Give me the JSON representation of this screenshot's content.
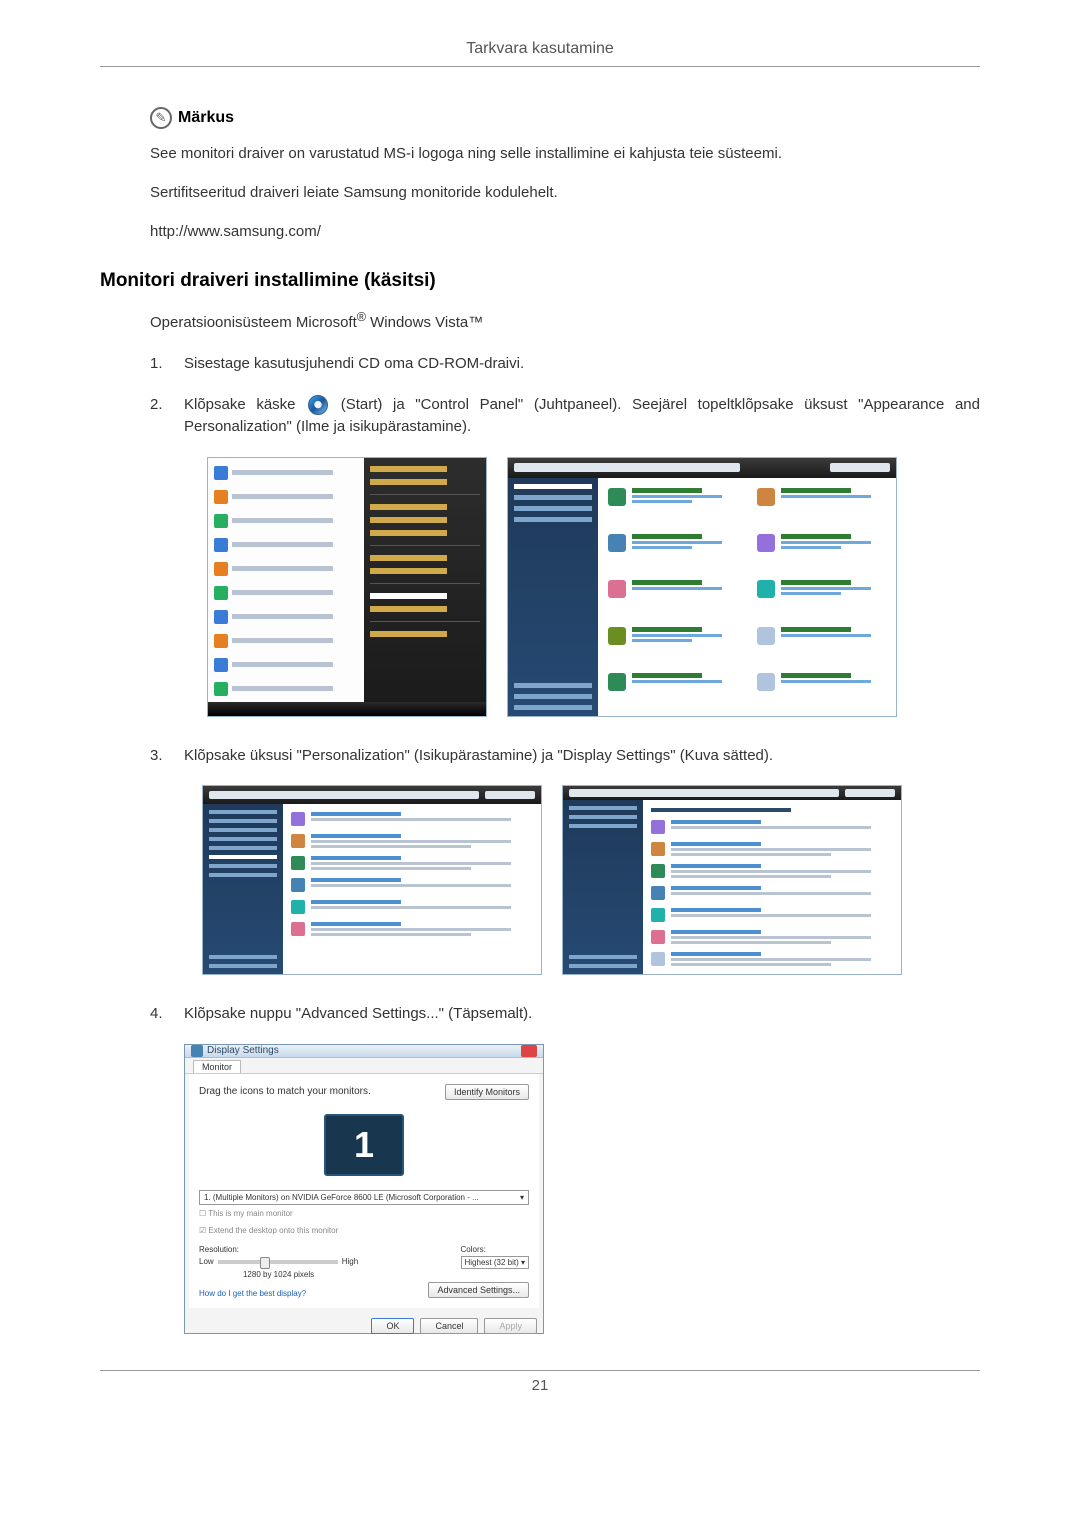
{
  "header": {
    "title": "Tarkvara kasutamine"
  },
  "note": {
    "label": "Märkus"
  },
  "paragraphs": {
    "p1": "See monitori draiver on varustatud MS-i logoga ning selle installimine ei kahjusta teie süsteemi.",
    "p2": "Sertifitseeritud draiveri leiate Samsung monitoride kodulehelt.",
    "p3": "http://www.samsung.com/"
  },
  "section": {
    "heading": "Monitori draiveri installimine (käsitsi)",
    "os_prefix": "Operatsioonisüsteem Microsoft",
    "os_reg": "®",
    "os_suffix": " Windows Vista™"
  },
  "steps": {
    "s1": {
      "num": "1.",
      "text": "Sisestage kasutusjuhendi CD oma CD-ROM-draivi."
    },
    "s2": {
      "num": "2.",
      "before": "Klõpsake käske ",
      "after": "(Start) ja \"Control Panel\" (Juhtpaneel). Seejärel topeltklõpsake üksust \"Appearance and Personalization\" (Ilme ja isikupärastamine)."
    },
    "s3": {
      "num": "3.",
      "text": "Klõpsake üksusi \"Personalization\" (Isikupärastamine) ja \"Display Settings\" (Kuva sätted)."
    },
    "s4": {
      "num": "4.",
      "text": "Klõpsake nuppu \"Advanced Settings...\" (Täpsemalt)."
    }
  },
  "display_settings": {
    "title": "Display Settings",
    "tab": "Monitor",
    "drag_text": "Drag the icons to match your monitors.",
    "identify_btn": "Identify Monitors",
    "monitor_num": "1",
    "combo_text": "1. (Multiple Monitors) on NVIDIA GeForce 8600 LE (Microsoft Corporation - ...",
    "chk1": "This is my main monitor",
    "chk2": "Extend the desktop onto this monitor",
    "res_label": "Resolution:",
    "res_low": "Low",
    "res_high": "High",
    "res_value": "1280 by 1024 pixels",
    "color_label": "Colors:",
    "color_value": "Highest (32 bit)",
    "link": "How do I get the best display?",
    "adv_btn": "Advanced Settings...",
    "ok": "OK",
    "cancel": "Cancel",
    "apply": "Apply"
  },
  "footer": {
    "page": "21"
  }
}
